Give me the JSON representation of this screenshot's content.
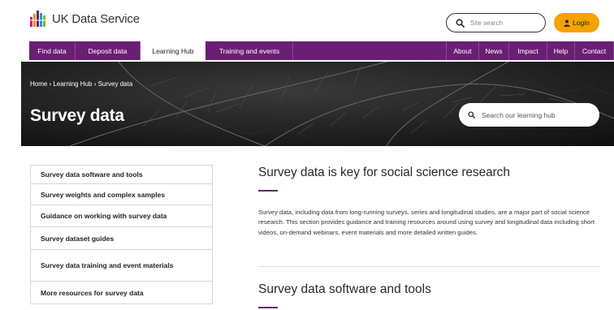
{
  "brand": {
    "name": "UK Data Service"
  },
  "header": {
    "search_placeholder": "Site search",
    "login_label": "Login"
  },
  "nav": {
    "left": [
      {
        "label": "Find data",
        "active": false
      },
      {
        "label": "Deposit data",
        "active": false
      },
      {
        "label": "Learning Hub",
        "active": true
      },
      {
        "label": "Training and events",
        "active": false
      }
    ],
    "right": [
      {
        "label": "About"
      },
      {
        "label": "News"
      },
      {
        "label": "Impact"
      },
      {
        "label": "Help"
      },
      {
        "label": "Contact"
      }
    ]
  },
  "hero": {
    "breadcrumb": "Home › Learning Hub › Survey data",
    "title": "Survey data",
    "search_placeholder": "Search our learning hub"
  },
  "sidebar": {
    "items": [
      {
        "label": "Survey data software and tools"
      },
      {
        "label": "Survey weights and complex samples"
      },
      {
        "label": "Guidance on working with survey data"
      },
      {
        "label": "Survey dataset guides"
      },
      {
        "label": "Survey data training and event materials"
      },
      {
        "label": "More resources for survey data"
      }
    ]
  },
  "main": {
    "heading": "Survey data is key for social science research",
    "paragraph": "Survey data, including data from long-running surveys, series and longitudinal studies, are a major part of social science research. This section provides guidance and training resources around using survey and longitudinal data including short videos, on-demand webinars, event materials and more detailed written guides.",
    "subheading": "Survey data software and tools"
  },
  "colors": {
    "brand_purple": "#6a1e74",
    "login_orange": "#f4a300"
  },
  "icons": {
    "search": "search-icon",
    "user": "user-icon",
    "logo": "uk-data-service-logo"
  }
}
